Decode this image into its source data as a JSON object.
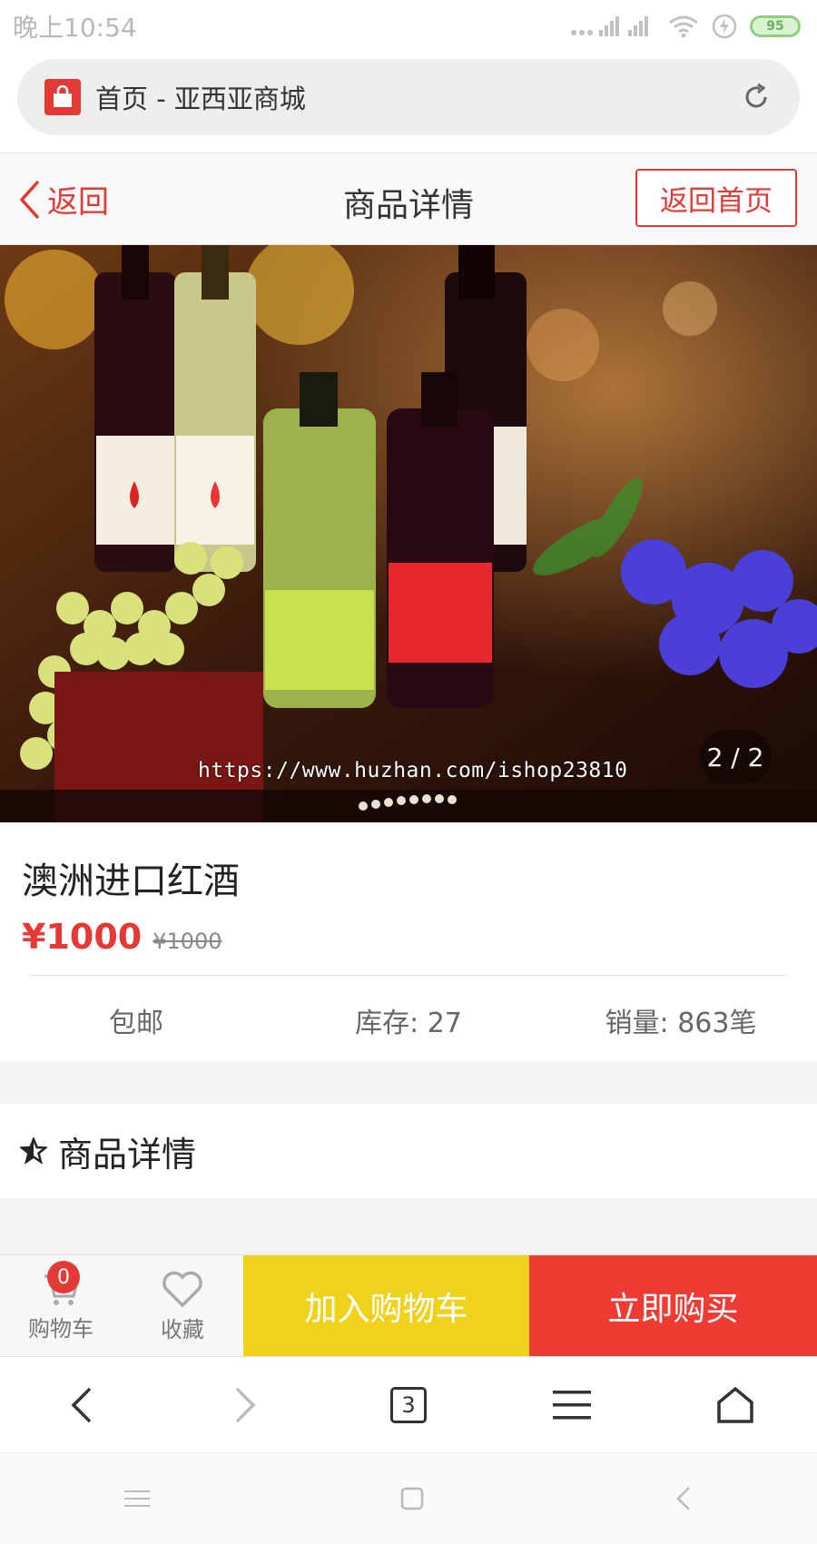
{
  "status_bar": {
    "time": "晚上10:54",
    "battery": "95"
  },
  "browser": {
    "url_title": "首页 - 亚西亚商城",
    "tab_count": "3"
  },
  "header": {
    "back_label": "返回",
    "title": "商品详情",
    "home_label": "返回首页"
  },
  "gallery": {
    "pager": "2 / 2",
    "watermark": "https://www.huzhan.com/ishop23810"
  },
  "product": {
    "name": "澳洲进口红酒",
    "price": "¥1000",
    "original_price": "¥1000",
    "shipping": "包邮",
    "stock": "库存: 27",
    "sales": "销量: 863笔"
  },
  "detail_section": {
    "title": "商品详情"
  },
  "action_bar": {
    "cart_label": "购物车",
    "cart_count": "0",
    "favorite_label": "收藏",
    "add_to_cart": "加入购物车",
    "buy_now": "立即购买"
  },
  "colors": {
    "accent": "#e53935",
    "cart_button": "#f0d21c",
    "buy_button": "#ef3b34"
  }
}
